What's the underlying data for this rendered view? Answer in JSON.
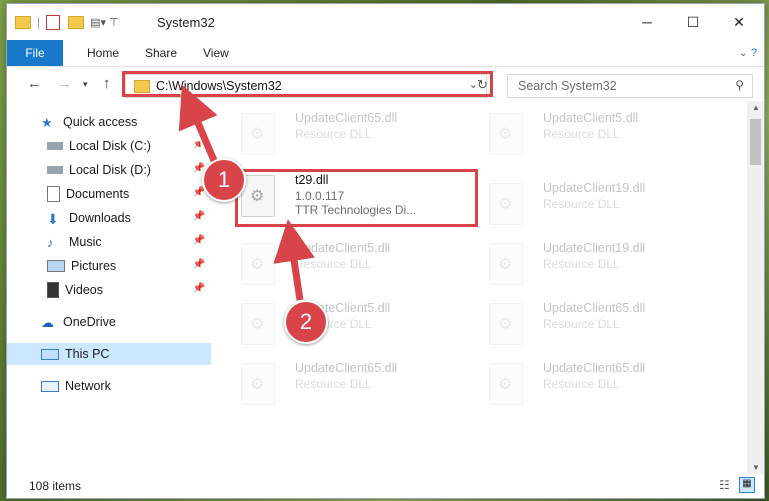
{
  "window": {
    "title": "System32",
    "controls": {
      "minimize": "─",
      "maximize": "☐",
      "close": "✕"
    }
  },
  "ribbon": {
    "tabs": [
      "File",
      "Home",
      "Share",
      "View"
    ]
  },
  "address": {
    "path": "C:\\Windows\\System32",
    "search_placeholder": "Search System32"
  },
  "sidebar": {
    "items": [
      {
        "label": "Quick access",
        "icon": "star-icon"
      },
      {
        "label": "Local Disk (C:)",
        "icon": "drive-icon"
      },
      {
        "label": "Local Disk (D:)",
        "icon": "drive-icon"
      },
      {
        "label": "Documents",
        "icon": "documents-icon"
      },
      {
        "label": "Downloads",
        "icon": "downloads-icon"
      },
      {
        "label": "Music",
        "icon": "music-icon"
      },
      {
        "label": "Pictures",
        "icon": "pictures-icon"
      },
      {
        "label": "Videos",
        "icon": "videos-icon"
      },
      {
        "label": "OneDrive",
        "icon": "onedrive-icon"
      },
      {
        "label": "This PC",
        "icon": "pc-icon"
      },
      {
        "label": "Network",
        "icon": "network-icon"
      }
    ]
  },
  "files": {
    "left": [
      {
        "name": "UpdateClient65.dll",
        "desc": "Resource DLL",
        "dim": true
      },
      {
        "name": "t29.dll",
        "version": "1.0.0.117",
        "desc": "TTR Technologies Di...",
        "dim": false
      },
      {
        "name": "UpdateClient5.dll",
        "desc": "Resource DLL",
        "dim": true
      },
      {
        "name": "UpdateClient5.dll",
        "desc": "Resource DLL",
        "dim": true
      },
      {
        "name": "UpdateClient65.dll",
        "desc": "Resource DLL",
        "dim": true
      }
    ],
    "right": [
      {
        "name": "UpdateClient5.dll",
        "desc": "Resource DLL"
      },
      {
        "name": "UpdateClient19.dll",
        "desc": "Resource DLL"
      },
      {
        "name": "UpdateClient19.dll",
        "desc": "Resource DLL"
      },
      {
        "name": "UpdateClient65.dll",
        "desc": "Resource DLL"
      },
      {
        "name": "UpdateClient65.dll",
        "desc": "Resource DLL"
      }
    ]
  },
  "status": {
    "items": "108 items"
  },
  "annotations": {
    "badge1": "1",
    "badge2": "2",
    "accent": "#d9444a"
  },
  "colors": {
    "file_tab": "#1979ca",
    "selection": "#cce8ff"
  }
}
